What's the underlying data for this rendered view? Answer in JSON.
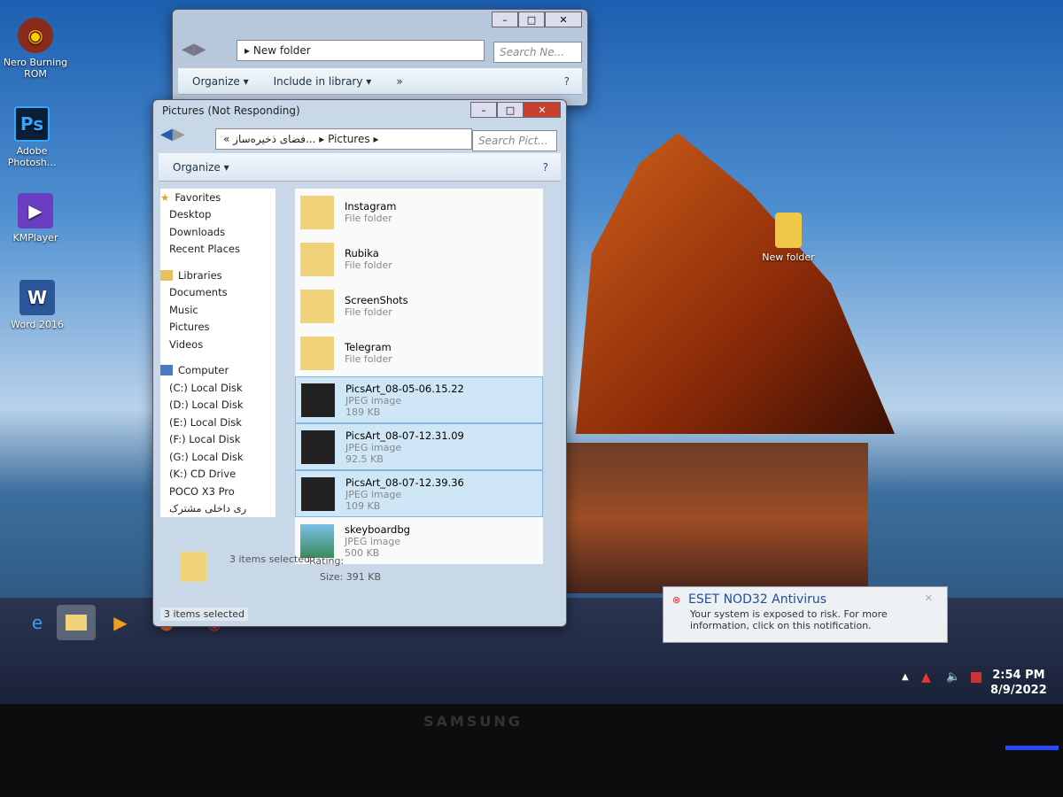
{
  "desktop": {
    "icons": [
      {
        "label": "Nero Burning ROM",
        "icon": "nero-icon"
      },
      {
        "label": "Adobe Photosh...",
        "icon": "photoshop-icon"
      },
      {
        "label": "KMPlayer",
        "icon": "kmplayer-icon"
      },
      {
        "label": "Word 2016",
        "icon": "word-icon"
      },
      {
        "label": "New folder",
        "icon": "folder-icon"
      }
    ]
  },
  "back_window": {
    "address": "New folder",
    "search_placeholder": "Search Ne...",
    "toolbar": [
      "Organize ▾",
      "Include in library ▾",
      "»"
    ],
    "controls": [
      "–",
      "□",
      "✕"
    ]
  },
  "front_window": {
    "title": "Pictures (Not Responding)",
    "address_root": "فضای ذخیره‌ساز...",
    "address_prefix": "«",
    "address_leaf": "Pictures",
    "search_placeholder": "Search Pict...",
    "organize": "Organize ▾",
    "controls": [
      "–",
      "□",
      "✕"
    ],
    "nav": {
      "favorites": "Favorites",
      "fav_items": [
        "Desktop",
        "Downloads",
        "Recent Places"
      ],
      "libraries": "Libraries",
      "lib_items": [
        "Documents",
        "Music",
        "Pictures",
        "Videos"
      ],
      "computer": "Computer",
      "comp_items": [
        "(C:) Local Disk",
        "(D:) Local Disk",
        "(E:) Local Disk",
        "(F:) Local Disk",
        "(G:) Local Disk",
        "(K:) CD Drive",
        "POCO X3 Pro",
        "ری داخلی مشترک"
      ]
    },
    "files": [
      {
        "name": "Instagram",
        "type": "File folder",
        "size": "",
        "selected": false,
        "kind": "folder"
      },
      {
        "name": "Rubika",
        "type": "File folder",
        "size": "",
        "selected": false,
        "kind": "folder"
      },
      {
        "name": "ScreenShots",
        "type": "File folder",
        "size": "",
        "selected": false,
        "kind": "folder"
      },
      {
        "name": "Telegram",
        "type": "File folder",
        "size": "",
        "selected": false,
        "kind": "folder"
      },
      {
        "name": "PicsArt_08-05-06.15.22",
        "type": "JPEG image",
        "size": "189 KB",
        "selected": true,
        "kind": "image"
      },
      {
        "name": "PicsArt_08-07-12.31.09",
        "type": "JPEG image",
        "size": "92.5 KB",
        "selected": true,
        "kind": "image"
      },
      {
        "name": "PicsArt_08-07-12.39.36",
        "type": "JPEG image",
        "size": "109 KB",
        "selected": true,
        "kind": "image"
      },
      {
        "name": "skeyboardbg",
        "type": "JPEG image",
        "size": "500 KB",
        "selected": false,
        "kind": "image"
      }
    ],
    "details": {
      "selected": "3 items selected",
      "rating": "Rating:",
      "size": "Size: 391 KB"
    },
    "status": "3 items selected"
  },
  "notification": {
    "title": "ESET NOD32 Antivirus",
    "message": "Your system is exposed to risk. For more information, click on this notification."
  },
  "taskbar": {
    "apps": [
      "internet-explorer-icon",
      "file-explorer-icon",
      "media-player-icon",
      "firefox-icon",
      "chrome-icon"
    ],
    "time": "2:54 PM",
    "date": "8/9/2022"
  },
  "monitor": {
    "brand": "SAMSUNG"
  }
}
